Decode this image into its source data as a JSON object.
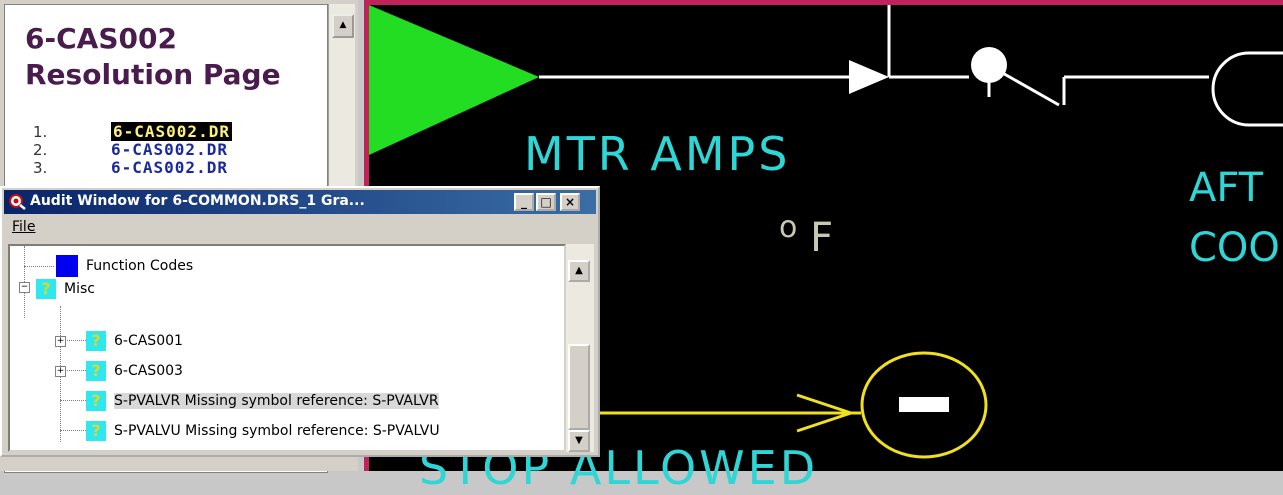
{
  "resolution_page": {
    "title_line1": "6-CAS002",
    "title_line2": "Resolution Page",
    "items": [
      {
        "num": "1.",
        "label": "6-CAS002.DR",
        "highlighted": true
      },
      {
        "num": "2.",
        "label": "6-CAS002.DR",
        "highlighted": false
      },
      {
        "num": "3.",
        "label": "6-CAS002.DR",
        "highlighted": false
      }
    ]
  },
  "schematic": {
    "mtr_amps": "MTR AMPS",
    "deg_symbol": "o",
    "unit_f": "F",
    "aft": "AFT",
    "coo": "COO",
    "stop_allowed": "STOP ALLOWED",
    "colors": {
      "text": "#2fd6d6",
      "line": "#ffffff",
      "triangle": "#22dd22",
      "highlight": "#f0e020",
      "border": "#c0235a"
    }
  },
  "audit_window": {
    "title": "Audit Window for 6-COMMON.DRS_1 Gra...",
    "minimize": "_",
    "maximize": "□",
    "close": "×",
    "menu": {
      "file": "File"
    },
    "tree": [
      {
        "label": "Function Codes",
        "icon": "blue-square-icon"
      },
      {
        "label": "Misc",
        "icon": "question-icon",
        "expanded": true
      },
      {
        "label": "6-CAS001",
        "icon": "question-icon"
      },
      {
        "label": "6-CAS003",
        "icon": "question-icon"
      },
      {
        "label": "S-PVALVR Missing symbol reference: S-PVALVR",
        "icon": "question-icon",
        "selected": true
      },
      {
        "label": "S-PVALVU Missing symbol reference: S-PVALVU",
        "icon": "question-icon"
      }
    ],
    "icon_glyph": "?"
  }
}
